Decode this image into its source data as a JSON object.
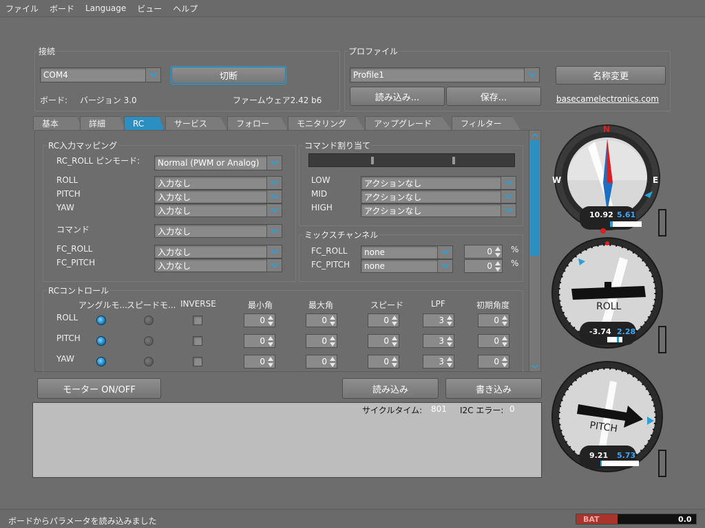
{
  "menu": [
    "ファイル",
    "ボード",
    "Language",
    "ビュー",
    "ヘルプ"
  ],
  "connection": {
    "title": "接続",
    "port": "COM4",
    "disconnect_label": "切断",
    "board_label": "ボード:",
    "version": "バージョン 3.0",
    "firmware": "ファームウェア2.42 b6"
  },
  "profile": {
    "title": "プロファイル",
    "selected": "Profile1",
    "rename_label": "名称変更",
    "load_label": "読み込み...",
    "save_label": "保存...",
    "link": "basecamelectronics.com"
  },
  "tabs": [
    "基本",
    "詳細",
    "RC",
    "サービス",
    "フォロー",
    "モニタリング",
    "アップグレード",
    "フィルター"
  ],
  "rc_input": {
    "title": "RC入力マッピング",
    "pin_mode_label": "RC_ROLL ピンモード:",
    "pin_mode_value": "Normal (PWM or Analog)",
    "rows": [
      {
        "label": "ROLL",
        "value": "入力なし"
      },
      {
        "label": "PITCH",
        "value": "入力なし"
      },
      {
        "label": "YAW",
        "value": "入力なし"
      },
      {
        "label": "コマンド",
        "value": "入力なし"
      },
      {
        "label": "FC_ROLL",
        "value": "入力なし"
      },
      {
        "label": "FC_PITCH",
        "value": "入力なし"
      }
    ]
  },
  "cmd_assign": {
    "title": "コマンド割り当て",
    "rows": [
      {
        "label": "LOW",
        "value": "アクションなし"
      },
      {
        "label": "MID",
        "value": "アクションなし"
      },
      {
        "label": "HIGH",
        "value": "アクションなし"
      }
    ]
  },
  "mix": {
    "title": "ミックスチャンネル",
    "rows": [
      {
        "label": "FC_ROLL",
        "value": "none",
        "amount": "0",
        "unit": "%"
      },
      {
        "label": "FC_PITCH",
        "value": "none",
        "amount": "0",
        "unit": "%"
      }
    ]
  },
  "rc_control": {
    "title": "RCコントロール",
    "headers": [
      "アングルモ...",
      "スピードモ...",
      "INVERSE",
      "最小角",
      "最大角",
      "スピード",
      "LPF",
      "初期角度"
    ],
    "rows": [
      {
        "axis": "ROLL",
        "angle_mode": true,
        "speed_mode": false,
        "inverse": false,
        "min": "0",
        "max": "0",
        "speed": "0",
        "lpf": "3",
        "init": "0"
      },
      {
        "axis": "PITCH",
        "angle_mode": true,
        "speed_mode": false,
        "inverse": false,
        "min": "0",
        "max": "0",
        "speed": "0",
        "lpf": "3",
        "init": "0"
      },
      {
        "axis": "YAW",
        "angle_mode": true,
        "speed_mode": false,
        "inverse": false,
        "min": "0",
        "max": "0",
        "speed": "0",
        "lpf": "3",
        "init": "0"
      }
    ]
  },
  "actions": {
    "motor_label": "モーター ON/OFF",
    "read_label": "読み込み",
    "write_label": "書き込み"
  },
  "console": {
    "cycle_label": "サイクルタイム:",
    "cycle_value": "801",
    "i2c_label": "I2C エラー:",
    "i2c_value": "0"
  },
  "gauges": {
    "compass": {
      "n": "N",
      "w": "W",
      "e": "E",
      "v1": "10.92",
      "v2": "5.61"
    },
    "roll": {
      "label": "ROLL",
      "v1": "-3.74",
      "v2": "2.28"
    },
    "pitch": {
      "label": "PITCH",
      "v1": "9.21",
      "v2": "5.73"
    }
  },
  "status": {
    "message": "ボードからパラメータを読み込みました",
    "bat_label": "BAT",
    "bat_value": "0.0"
  },
  "colors": {
    "accent": "#2b8fc2",
    "value_blue": "#3aa8ff",
    "bat_red": "#a8342a"
  }
}
